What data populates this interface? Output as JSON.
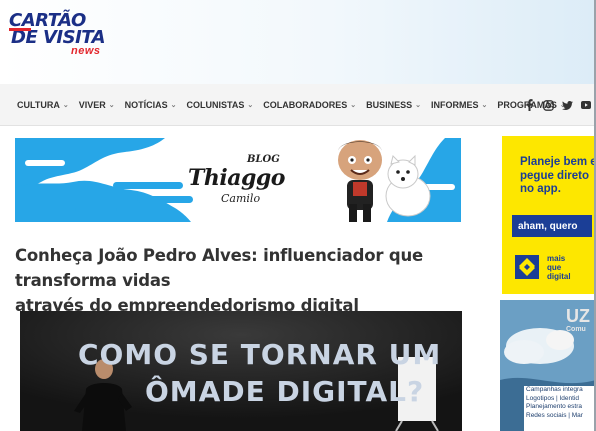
{
  "logo": {
    "line1": "CARTÃO",
    "line2": "DE VISITA",
    "news": "news"
  },
  "nav": {
    "items": [
      {
        "label": "CULTURA",
        "has_dropdown": true
      },
      {
        "label": "VIVER",
        "has_dropdown": true
      },
      {
        "label": "NOTÍCIAS",
        "has_dropdown": true
      },
      {
        "label": "COLUNISTAS",
        "has_dropdown": true
      },
      {
        "label": "COLABORADORES",
        "has_dropdown": true
      },
      {
        "label": "BUSINESS",
        "has_dropdown": true
      },
      {
        "label": "INFORMES",
        "has_dropdown": true
      },
      {
        "label": "PROGRAMAS",
        "has_dropdown": true
      }
    ],
    "social": {
      "facebook": "f",
      "instagram": "◎",
      "twitter": "🐦",
      "youtube": "▶"
    }
  },
  "banner": {
    "blog": "BLOG",
    "name": "Thiaggo",
    "surname": "Camilo"
  },
  "article": {
    "title_line1": "Conheça João Pedro Alves: influenciador que transforma vidas",
    "title_line2": "através do empreendedorismo digital",
    "image_line1": "COMO SE TORNAR UM",
    "image_line2": "ÔMADE DIGITAL?"
  },
  "ad_bb": {
    "text_line1": "Planeje bem e",
    "text_line2": "pegue direto",
    "text_line3": "no app.",
    "button": "aham, quero",
    "small_line1": "mais",
    "small_line2": "que",
    "small_line3": "digital"
  },
  "ad_uz": {
    "title": "UZ",
    "subtitle": "Comu",
    "lines": [
      "Campanhas integra",
      "Logotipos | Identid",
      "Planejamento estra",
      "Redes sociais | Mar"
    ]
  },
  "colors": {
    "logo_blue": "#1b2f86",
    "logo_red": "#e3262c",
    "banner_blue": "#27a6e7",
    "bb_yellow": "#fde700",
    "bb_blue": "#1b3e96"
  }
}
